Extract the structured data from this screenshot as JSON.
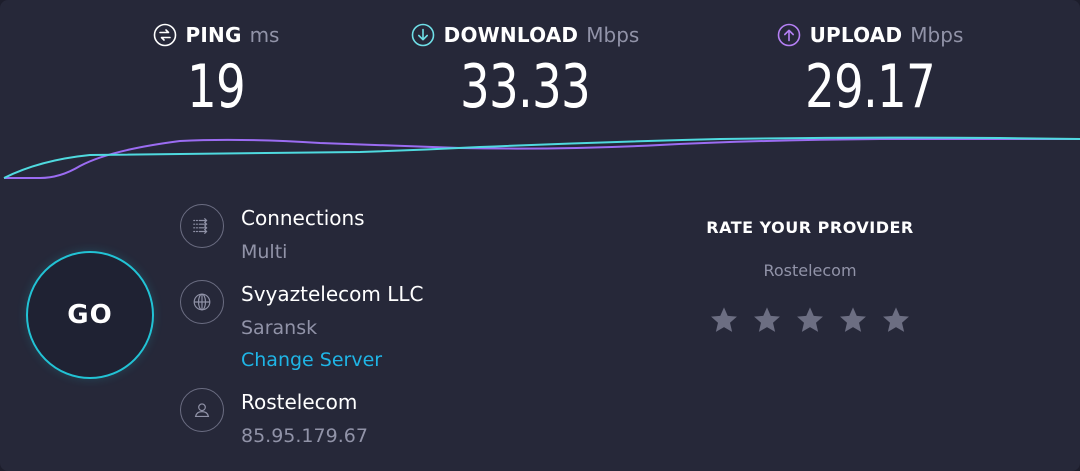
{
  "metrics": {
    "ping": {
      "label": "PING",
      "unit": "ms",
      "value": "19",
      "icon": "ping-icon",
      "color": "#ffffff"
    },
    "download": {
      "label": "DOWNLOAD",
      "unit": "Mbps",
      "value": "33.33",
      "icon": "download-arrow-icon",
      "color": "#6fe0e8"
    },
    "upload": {
      "label": "UPLOAD",
      "unit": "Mbps",
      "value": "29.17",
      "icon": "upload-arrow-icon",
      "color": "#b580f5"
    }
  },
  "graph": {
    "download_color": "#4fdadf",
    "upload_color": "#9b6cf2"
  },
  "go_button": {
    "label": "GO",
    "accent": "#22c3d5"
  },
  "connections": {
    "title": "Connections",
    "value": "Multi",
    "icon": "connections-icon"
  },
  "server": {
    "title": "Svyaztelecom LLC",
    "location": "Saransk",
    "change_label": "Change Server",
    "icon": "globe-icon"
  },
  "isp": {
    "title": "Rostelecom",
    "ip": "85.95.179.67",
    "icon": "user-icon"
  },
  "rating": {
    "title": "RATE YOUR PROVIDER",
    "provider": "Rostelecom",
    "stars_total": 5,
    "stars_selected": 0,
    "star_color": "#6c6e82"
  }
}
